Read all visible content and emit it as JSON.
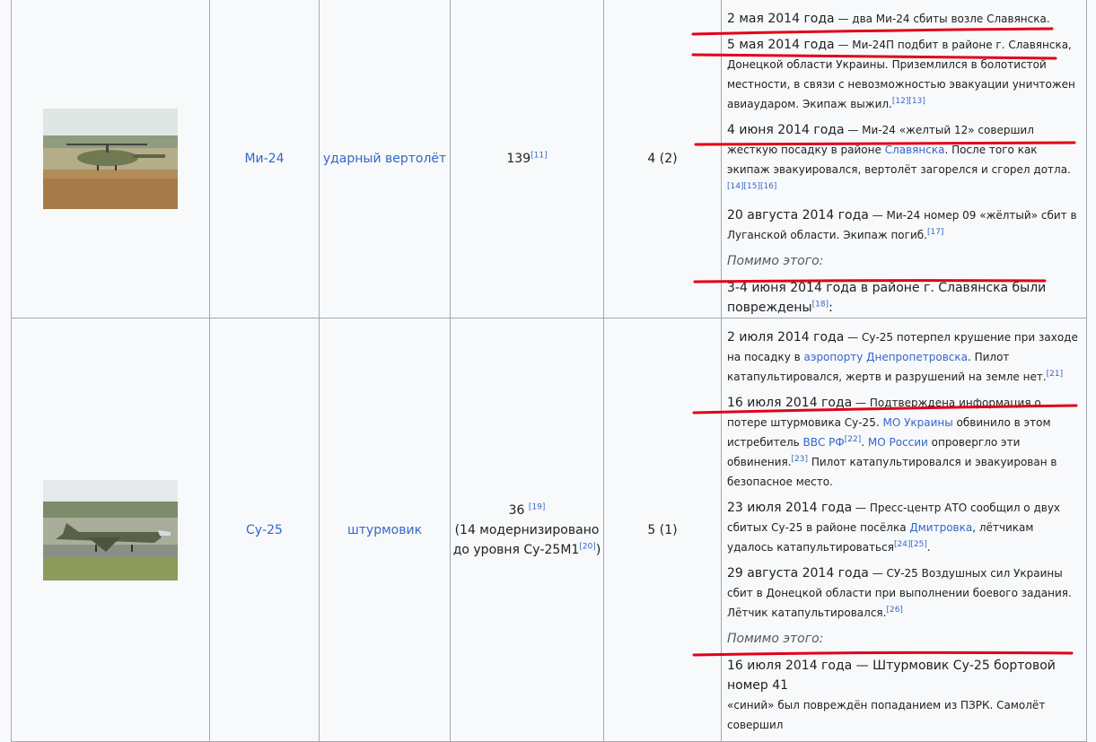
{
  "rows": [
    {
      "name": "Ми-24",
      "role": "ударный вертолёт",
      "count": "139",
      "count_ref": "[11]",
      "losses": "4 (2)",
      "events": [
        {
          "date": "2 мая 2014 года",
          "text": " — два Ми-24 сбиты возле Славянска."
        },
        {
          "date": "5 мая 2014 года",
          "text": " — Ми-24П подбит в районе г. Славянска, Донецкой области Украины. Приземлился в болотистой местности, в связи с невозможностью эвакуации уничтожен авиаударом. Экипаж выжил.",
          "refs": "[12][13]"
        },
        {
          "date": "4 июня 2014 года",
          "text_pre": " — Ми-24 «желтый 12» совершил жёсткую посадку в районе ",
          "link": "Славянска",
          "text": ". После того как экипаж эвакуировался, вертолёт загорелся и сгорел дотла.",
          "refs": "[14][15][16]"
        },
        {
          "date": "20 августа 2014 года",
          "text": " — Ми-24 номер 09 «жёлтый» сбит в Луганской области. Экипаж погиб.",
          "refs": "[17]"
        }
      ],
      "also": "Помимо этого:",
      "also_text": "3-4 июня 2014 года в районе г. Славянска были повреждены",
      "also_ref": "[18]",
      "also_tail": ":"
    },
    {
      "name": "Су-25",
      "role": "штурмовик",
      "count": "36 ",
      "count_ref": "[19]",
      "count_note": "(14 модернизировано до уровня Су-25М1",
      "count_note_ref": "[20]",
      "count_note_tail": ")",
      "losses": "5 (1)",
      "events": [
        {
          "date": "2 июля 2014 года",
          "text_pre": " — Су-25 потерпел крушение при заходе на посадку в ",
          "link": "аэропорту Днепропетровска",
          "text": ". Пилот катапультировался, жертв и разрушений на земле нет.",
          "refs": "[21]"
        },
        {
          "date": "16 июля 2014 года",
          "text_pre": " — Подтверждена информация о потере штурмовика Су-25. ",
          "link": "МО Украины",
          "text_mid": " обвинило в этом истребитель ",
          "link2": "ВВС РФ",
          "refs_mid": "[22]",
          "text_mid2": ". ",
          "link3": "МО России",
          "text": " опровергло эти обвинения.",
          "refs": "[23]",
          "text_tail": " Пилот катапультировался и эвакуирован в безопасное место."
        },
        {
          "date": "23 июля 2014 года",
          "text_pre": " — Пресс-центр АТО сообщил о двух сбитых Су-25 в районе посёлка ",
          "link": "Дмитровка",
          "text": ", лётчикам удалось катапультироваться",
          "refs": "[24][25]",
          "text_tail": "."
        },
        {
          "date": "29 августа 2014 года",
          "text": " — СУ-25 Воздушных сил Украины сбит в Донецкой области при выполнении боевого задания. Лётчик катапультировался.",
          "refs": "[26]"
        }
      ],
      "also": "Помимо этого:",
      "also_text": "16 июля 2014 года — Штурмовик Су-25 бортовой номер 41",
      "also_tail_line": "«синий» был повреждён попаданием из ПЗРК. Самолёт совершил"
    }
  ],
  "colors": {
    "link": "#3366cc",
    "annotation": "#e0001b",
    "border": "#a2a9b1"
  },
  "icons": [
    "helicopter-photo",
    "jet-photo"
  ]
}
